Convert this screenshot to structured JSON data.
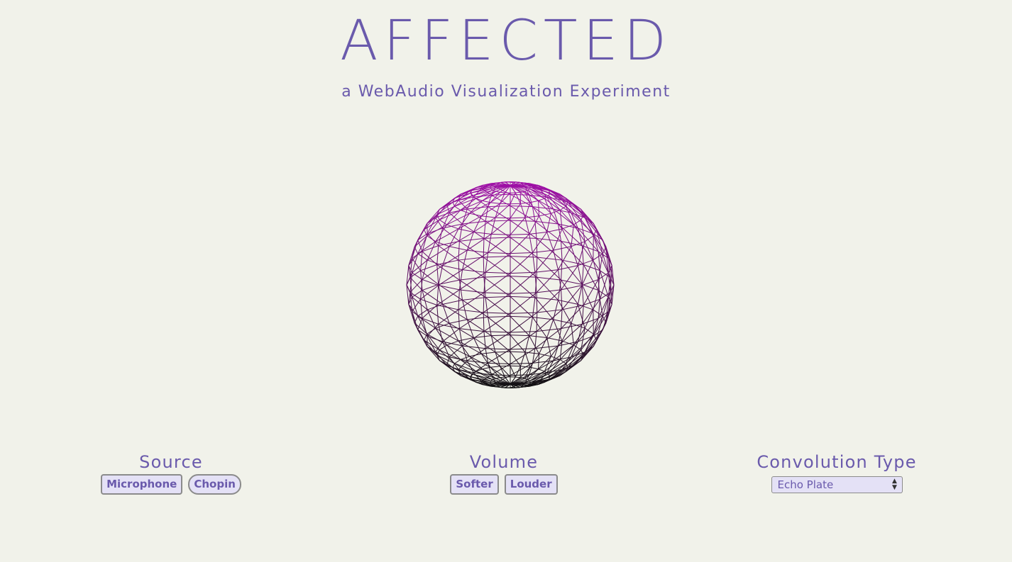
{
  "header": {
    "title": "AFFECTED",
    "subtitle": "a WebAudio Visualization Experiment"
  },
  "controls": {
    "source": {
      "label": "Source",
      "buttons": [
        "Microphone",
        "Chopin"
      ]
    },
    "volume": {
      "label": "Volume",
      "buttons": [
        "Softer",
        "Louder"
      ]
    },
    "convolution": {
      "label": "Convolution Type",
      "selected": "Echo Plate"
    }
  },
  "colors": {
    "background": "#f1f2ea",
    "accent": "#6a5aac",
    "sphere_top": "#a010a8",
    "sphere_bottom": "#111111"
  }
}
